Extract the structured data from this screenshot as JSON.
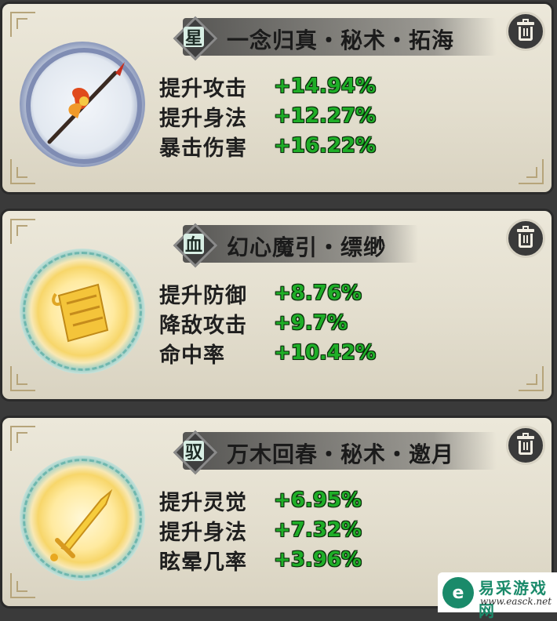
{
  "cards": [
    {
      "badge": "星",
      "title": "一念归真・秘术・拓海",
      "icon": "spear-icon",
      "stats": [
        {
          "name": "提升攻击",
          "value": "+14.94%"
        },
        {
          "name": "提升身法",
          "value": "+12.27%"
        },
        {
          "name": "暴击伤害",
          "value": "+16.22%"
        }
      ]
    },
    {
      "badge": "血",
      "title": "幻心魔引・缥缈",
      "icon": "scroll-icon",
      "stats": [
        {
          "name": "提升防御",
          "value": "+8.76%"
        },
        {
          "name": "降敌攻击",
          "value": "+9.7%"
        },
        {
          "name": "命中率",
          "value": "+10.42%"
        }
      ]
    },
    {
      "badge": "驭",
      "title": "万木回春・秘术・邀月",
      "icon": "sword-icon",
      "stats": [
        {
          "name": "提升灵觉",
          "value": "+6.95%"
        },
        {
          "name": "提升身法",
          "value": "+7.32%"
        },
        {
          "name": "眩晕几率",
          "value": "+3.96%"
        }
      ]
    }
  ],
  "watermark": {
    "name": "易采游戏网",
    "url": "www.easck.net"
  },
  "colors": {
    "stat_value": "#1fae28",
    "card_bg": "#e6e1d2"
  }
}
